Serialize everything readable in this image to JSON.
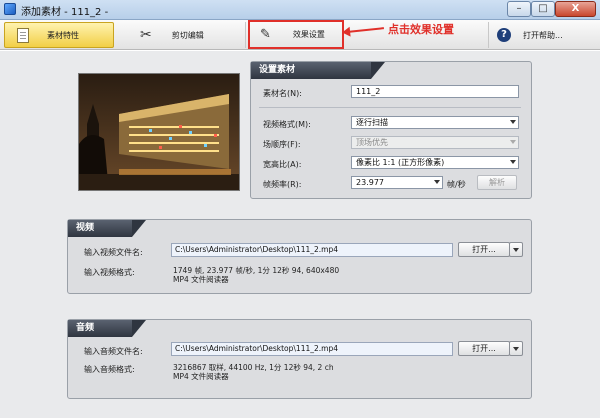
{
  "window": {
    "title": "添加素材 - 111_2 -",
    "min": "–",
    "max": "□",
    "close": "X"
  },
  "toolbar": {
    "material_props": "素材特性",
    "cut_edit": "剪切编辑",
    "effect_settings": "效果设置",
    "help": "打开帮助...",
    "annotation": "点击效果设置"
  },
  "settings": {
    "header": "设置素材",
    "name_label": "素材名(N):",
    "name_value": "111_2",
    "video_format_label": "视频格式(M):",
    "video_format_value": "逐行扫描",
    "field_order_label": "场顺序(F):",
    "field_order_value": "顶场优先",
    "aspect_label": "宽高比(A):",
    "aspect_value": "像素比 1:1 (正方形像素)",
    "fps_label": "帧频率(R):",
    "fps_value": "23.977",
    "fps_unit": "帧/秒",
    "analyze_button": "解析"
  },
  "video": {
    "header": "视频",
    "file_label": "输入视频文件名:",
    "file_value": "C:\\Users\\Administrator\\Desktop\\111_2.mp4",
    "open_button": "打开...",
    "format_label": "输入视频格式:",
    "format_line1": "1749 帧, 23.977 帧/秒, 1分 12秒 94, 640x480",
    "format_line2": "MP4 文件阅读器"
  },
  "audio": {
    "header": "音频",
    "file_label": "输入音频文件名:",
    "file_value": "C:\\Users\\Administrator\\Desktop\\111_2.mp4",
    "open_button": "打开...",
    "format_label": "输入音频格式:",
    "format_line1": "3216867 取样, 44100 Hz, 1分 12秒 94, 2 ch",
    "format_line2": "MP4 文件阅读器"
  }
}
